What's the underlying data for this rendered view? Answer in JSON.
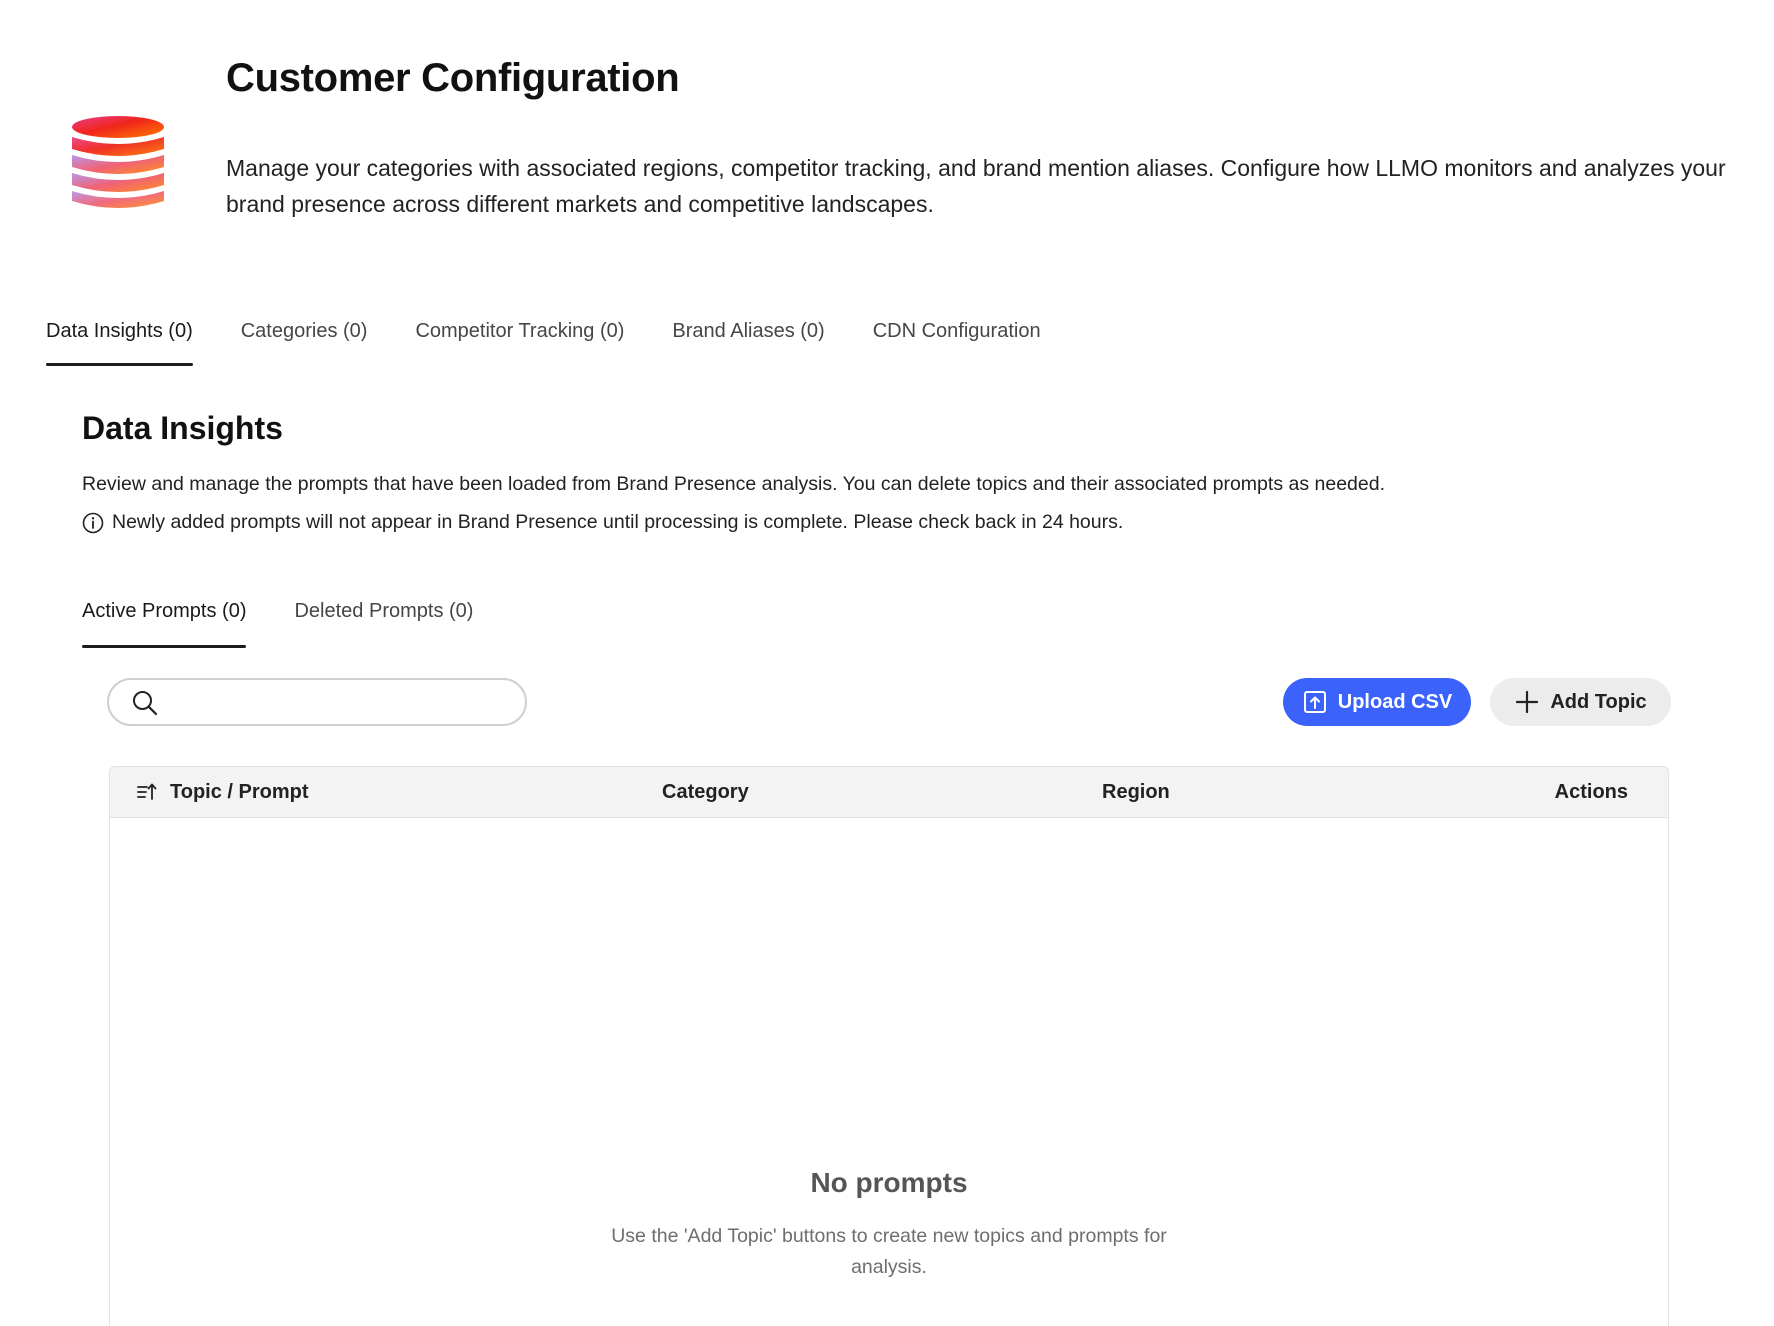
{
  "header": {
    "title": "Customer Configuration",
    "description": "Manage your categories with associated regions, competitor tracking, and brand mention aliases. Configure how LLMO monitors and analyzes your brand presence across different markets and competitive landscapes.",
    "logo_icon": "stacked-database-gradient-icon"
  },
  "main_tabs": [
    {
      "label": "Data Insights (0)",
      "selected": true
    },
    {
      "label": "Categories (0)",
      "selected": false
    },
    {
      "label": "Competitor Tracking (0)",
      "selected": false
    },
    {
      "label": "Brand Aliases (0)",
      "selected": false
    },
    {
      "label": "CDN Configuration",
      "selected": false
    }
  ],
  "section": {
    "title": "Data Insights",
    "description": "Review and manage the prompts that have been loaded from Brand Presence analysis. You can delete topics and their associated prompts as needed.",
    "info_text": "Newly added prompts will not appear in Brand Presence until processing is complete. Please check back in 24 hours.",
    "info_icon": "info-circle-icon"
  },
  "sub_tabs": [
    {
      "label": "Active Prompts (0)",
      "selected": true
    },
    {
      "label": "Deleted Prompts (0)",
      "selected": false
    }
  ],
  "search": {
    "value": "",
    "placeholder": "",
    "icon": "search-icon"
  },
  "toolbar": {
    "upload_label": "Upload CSV",
    "upload_icon": "upload-icon",
    "add_label": "Add Topic",
    "add_icon": "plus-icon"
  },
  "table": {
    "columns": [
      "Topic / Prompt",
      "Category",
      "Region",
      "Actions"
    ],
    "sort_icon": "sort-ascending-icon",
    "rows": [],
    "empty_title": "No prompts",
    "empty_description": "Use the 'Add Topic' buttons to create new topics and prompts for analysis."
  },
  "colors": {
    "primary_button": "#3b63fb",
    "secondary_button": "#ececec",
    "tab_indicator": "#1d1d1d",
    "table_header_bg": "#f3f3f3"
  }
}
